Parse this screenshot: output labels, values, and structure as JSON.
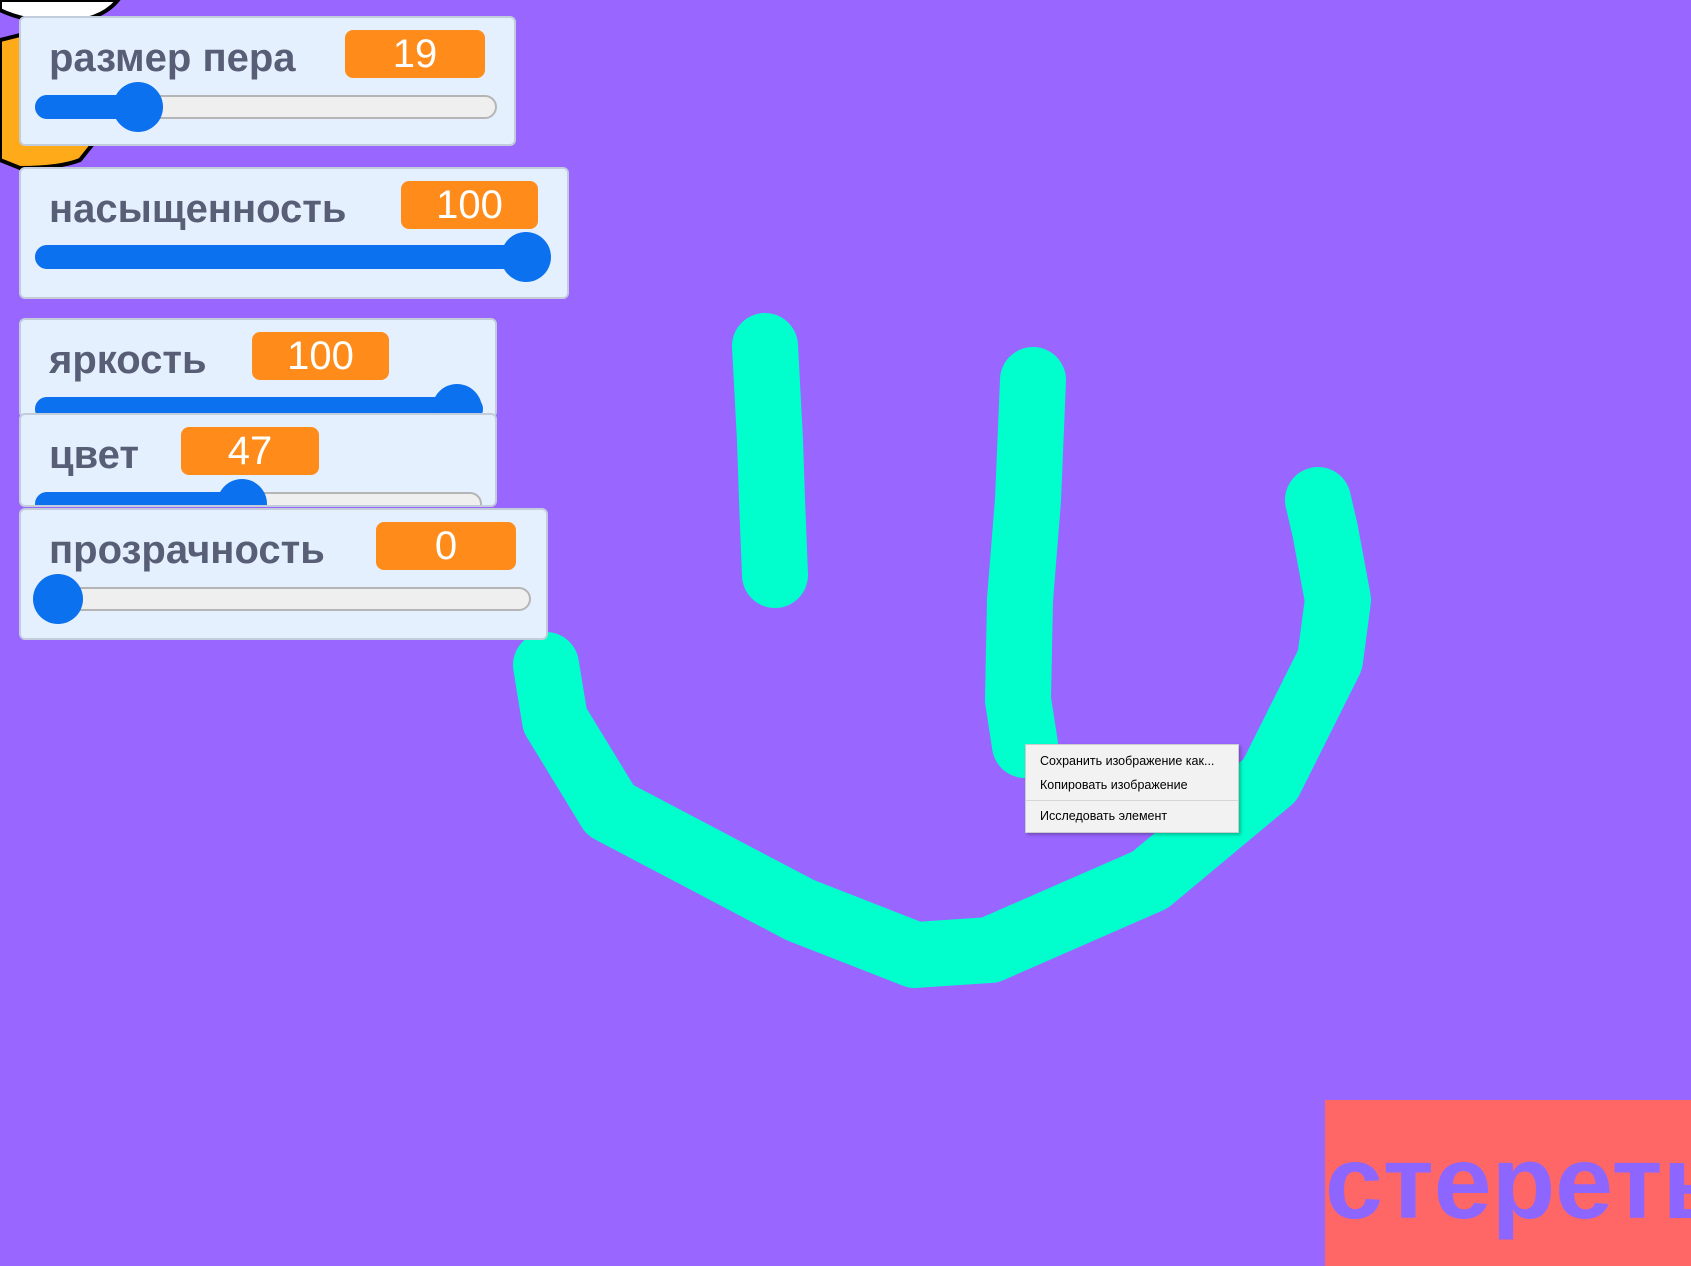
{
  "sliders": [
    {
      "label": "размер пера",
      "value": "19",
      "level_fraction": 0.2
    },
    {
      "label": "насыщенность",
      "value": "100",
      "level_fraction": 1.0
    },
    {
      "label": "яркость",
      "value": "100",
      "level_fraction": 1.0
    },
    {
      "label": "цвет",
      "value": "47",
      "level_fraction": 0.47
    },
    {
      "label": "прозрачность",
      "value": "0",
      "level_fraction": 0.0
    }
  ],
  "context_menu": {
    "items": [
      "Сохранить изображение как...",
      "Копировать изображение",
      "Исследовать элемент"
    ]
  },
  "erase_button": {
    "label": "стереть"
  },
  "colors": {
    "stage_background": "#9966FF",
    "pen_stroke": "#00FFCC",
    "monitor_value": "#FF8C1A",
    "slider": "#0B71EF",
    "erase_button_bg": "#FF6666",
    "erase_button_text": "#8C66FF"
  }
}
